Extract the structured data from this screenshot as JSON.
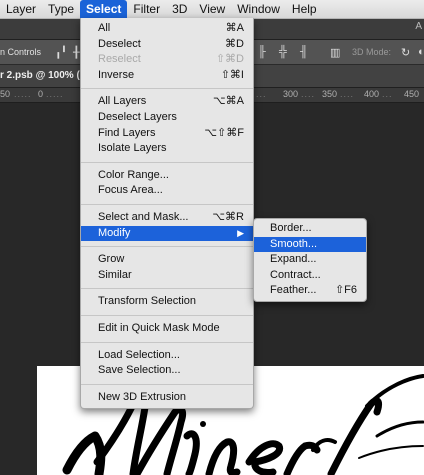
{
  "menubar": {
    "items": [
      "Layer",
      "Type",
      "Select",
      "Filter",
      "3D",
      "View",
      "Window",
      "Help"
    ],
    "active": "Select"
  },
  "optbar": {
    "app_title_fragment": "A"
  },
  "controls": {
    "label": "n Controls",
    "mode_label": "3D Mode:"
  },
  "document": {
    "tab_title": "r 2.psb @ 100% (L"
  },
  "ruler": {
    "left_ticks": [
      "50",
      "0"
    ],
    "right_ticks": [
      "300",
      "350",
      "400",
      "450"
    ]
  },
  "select_menu": {
    "group1": [
      {
        "label": "All",
        "shortcut": "⌘A",
        "enabled": true
      },
      {
        "label": "Deselect",
        "shortcut": "⌘D",
        "enabled": true
      },
      {
        "label": "Reselect",
        "shortcut": "⇧⌘D",
        "enabled": false
      },
      {
        "label": "Inverse",
        "shortcut": "⇧⌘I",
        "enabled": true
      }
    ],
    "group2": [
      {
        "label": "All Layers",
        "shortcut": "⌥⌘A"
      },
      {
        "label": "Deselect Layers",
        "shortcut": ""
      },
      {
        "label": "Find Layers",
        "shortcut": "⌥⇧⌘F"
      },
      {
        "label": "Isolate Layers",
        "shortcut": ""
      }
    ],
    "group3": [
      {
        "label": "Color Range...",
        "shortcut": ""
      },
      {
        "label": "Focus Area...",
        "shortcut": ""
      }
    ],
    "group4": [
      {
        "label": "Select and Mask...",
        "shortcut": "⌥⌘R"
      },
      {
        "label": "Modify",
        "shortcut": "▶"
      }
    ],
    "group5": [
      {
        "label": "Grow"
      },
      {
        "label": "Similar"
      }
    ],
    "group6": [
      {
        "label": "Transform Selection"
      }
    ],
    "group7": [
      {
        "label": "Edit in Quick Mask Mode"
      }
    ],
    "group8": [
      {
        "label": "Load Selection..."
      },
      {
        "label": "Save Selection..."
      }
    ],
    "group9": [
      {
        "label": "New 3D Extrusion"
      }
    ]
  },
  "modify_menu": {
    "items": [
      {
        "label": "Border...",
        "shortcut": ""
      },
      {
        "label": "Smooth...",
        "shortcut": ""
      },
      {
        "label": "Expand...",
        "shortcut": ""
      },
      {
        "label": "Contract...",
        "shortcut": ""
      },
      {
        "label": "Feather...",
        "shortcut": "⇧F6"
      }
    ],
    "highlighted": "Smooth..."
  },
  "colors": {
    "menu_highlight": "#1c62da",
    "menubar_active": "#1a63d8",
    "workspace": "#282828"
  }
}
